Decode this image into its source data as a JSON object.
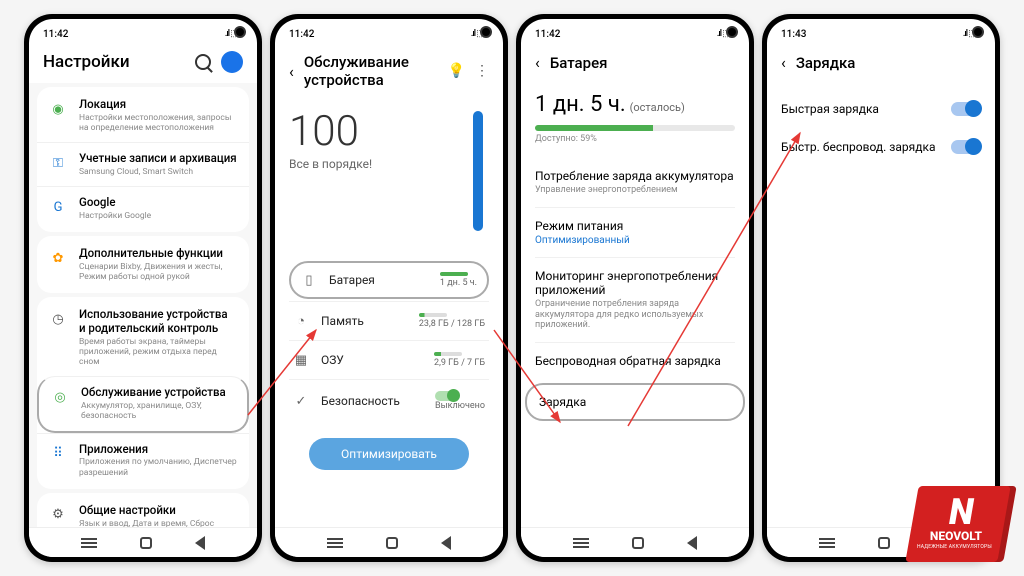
{
  "status": {
    "time1": "11:42",
    "time2": "11:42",
    "time3": "11:42",
    "time4": "11:43",
    "icons": ".ıl ⬚ ▮"
  },
  "p1": {
    "title": "Настройки",
    "rows": [
      {
        "t": "Локация",
        "s": "Настройки местоположения, запросы на определение местоположения",
        "ic": "◉",
        "cls": "ic-loc"
      },
      {
        "t": "Учетные записи и архивация",
        "s": "Samsung Cloud, Smart Switch",
        "ic": "⚿",
        "cls": "ic-key"
      },
      {
        "t": "Google",
        "s": "Настройки Google",
        "ic": "G",
        "cls": "ic-g"
      }
    ],
    "rows2": [
      {
        "t": "Дополнительные функции",
        "s": "Сценарии Bixby, Движения и жесты, Режим работы одной рукой",
        "ic": "✿",
        "cls": "ic-plus"
      }
    ],
    "rows3": [
      {
        "t": "Использование устройства и родительский контроль",
        "s": "Время работы экрана, таймеры приложений, режим отдыха перед сном",
        "ic": "◷",
        "cls": "ic-clock"
      },
      {
        "t": "Обслуживание устройства",
        "s": "Аккумулятор, хранилище, ОЗУ, безопасность",
        "ic": "◎",
        "cls": "ic-dev",
        "hl": true
      },
      {
        "t": "Приложения",
        "s": "Приложения по умолчанию, Диспетчер разрешений",
        "ic": "⠿",
        "cls": "ic-apps"
      }
    ],
    "rows4": [
      {
        "t": "Общие настройки",
        "s": "Язык и ввод, Дата и время, Сброс",
        "ic": "⚙",
        "cls": "ic-gear"
      }
    ]
  },
  "p2": {
    "title": "Обслуживание устройства",
    "score": "100",
    "ok": "Все в порядке!",
    "rows": [
      {
        "ic": "▯",
        "t": "Батарея",
        "v": "1 дн. 5 ч.",
        "bar": "p2-mini",
        "hl": true
      },
      {
        "ic": "◔",
        "t": "Память",
        "v": "23,8 ГБ / 128 ГБ",
        "bar": "p2-mini dual"
      },
      {
        "ic": "▦",
        "t": "ОЗУ",
        "v": "2,9 ГБ / 7 ГБ",
        "bar": "p2-mini tri"
      },
      {
        "ic": "✓",
        "t": "Безопасность",
        "v": "Выключено",
        "toggle": true
      }
    ],
    "btn": "Оптимизировать"
  },
  "p3": {
    "title": "Батарея",
    "big": "1 дн. 5 ч.",
    "rem": "(осталось)",
    "avail": "Доступно: 59%",
    "items": [
      {
        "t": "Потребление заряда аккумулятора",
        "s": "Управление энергопотреблением"
      },
      {
        "t": "Режим питания",
        "v": "Оптимизированный"
      },
      {
        "t": "Мониторинг энергопотребления приложений",
        "s": "Ограничение потребления заряда аккумулятора для редко используемых приложений."
      },
      {
        "t": "Беспроводная обратная зарядка"
      },
      {
        "t": "Зарядка",
        "hl": true
      }
    ]
  },
  "p4": {
    "title": "Зарядка",
    "rows": [
      {
        "t": "Быстрая зарядка"
      },
      {
        "t": "Быстр. беспровод. зарядка"
      }
    ]
  },
  "logo": {
    "brand": "NEOVOLT",
    "sub": "НАДЕЖНЫЕ АККУМУЛЯТОРЫ",
    "n": "N"
  }
}
